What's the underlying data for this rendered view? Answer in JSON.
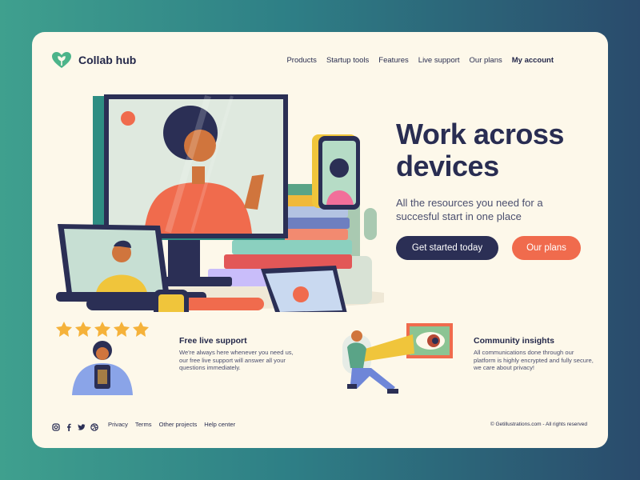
{
  "brand": {
    "name": "Collab hub",
    "icon": "heart-leaf-icon"
  },
  "nav": {
    "items": [
      {
        "label": "Products"
      },
      {
        "label": "Startup tools"
      },
      {
        "label": "Features"
      },
      {
        "label": "Live support"
      },
      {
        "label": "Our plans"
      },
      {
        "label": "My account"
      }
    ]
  },
  "hero": {
    "title": "Work across devices",
    "subtitle": "All the resources you need for a succesful start in one place",
    "primary_button": "Get started today",
    "secondary_button": "Our plans"
  },
  "features": [
    {
      "title": "Free live support",
      "text": "We're always here whenever you need us, our free live support will answer all your questions immediately.",
      "icon": "rating-stars-person-illustration"
    },
    {
      "title": "Community insights",
      "text": "All communications done through our platform is highly encrypted and fully secure, we care about privacy!",
      "icon": "telescope-eye-illustration"
    }
  ],
  "footer": {
    "social": [
      "instagram-icon",
      "facebook-icon",
      "twitter-icon",
      "dribbble-icon"
    ],
    "links": [
      {
        "label": "Privacy"
      },
      {
        "label": "Terms"
      },
      {
        "label": "Other projects"
      },
      {
        "label": "Help center"
      }
    ],
    "copyright": "© Getillustrations.com - All rights reserved"
  },
  "colors": {
    "background_left": "#3fa08e",
    "background_right": "#2a4b6c",
    "card": "#fdf8ea",
    "primary": "#2b2f55",
    "accent": "#f06b4d"
  }
}
